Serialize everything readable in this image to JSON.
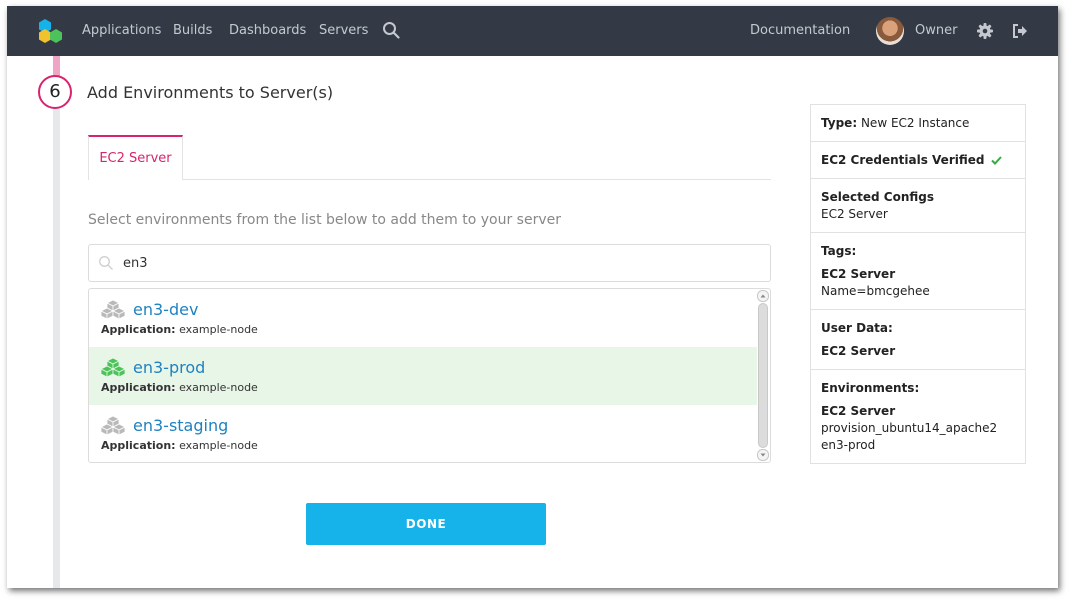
{
  "nav": {
    "items": [
      "Applications",
      "Builds",
      "Dashboards",
      "Servers"
    ],
    "documentation": "Documentation",
    "user": "Owner",
    "logo_colors": [
      "#16b2ea",
      "#f2c12e",
      "#4cc35a"
    ]
  },
  "step": {
    "number": "6",
    "title": "Add Environments to Server(s)"
  },
  "tabs": [
    {
      "label": "EC2 Server",
      "active": true
    }
  ],
  "instruction": "Select environments from the list below to add them to your server",
  "search": {
    "value": "en3",
    "placeholder": ""
  },
  "environments": [
    {
      "name": "en3-dev",
      "app_label": "Application:",
      "app_value": "example-node",
      "selected": false
    },
    {
      "name": "en3-prod",
      "app_label": "Application:",
      "app_value": "example-node",
      "selected": true
    },
    {
      "name": "en3-staging",
      "app_label": "Application:",
      "app_value": "example-node",
      "selected": false
    }
  ],
  "done_label": "DONE",
  "summary": {
    "type_label": "Type:",
    "type_value": "New EC2 Instance",
    "credentials": "EC2 Credentials Verified",
    "selected_configs_label": "Selected Configs",
    "selected_configs_value": "EC2 Server",
    "tags_label": "Tags:",
    "tags_server": "EC2 Server",
    "tags_value": "Name=bmcgehee",
    "user_data_label": "User Data:",
    "user_data_server": "EC2 Server",
    "environments_label": "Environments:",
    "environments_server": "EC2 Server",
    "environments_values": [
      "provision_ubuntu14_apache2",
      "en3-prod"
    ]
  },
  "colors": {
    "nav_bg": "#333a45",
    "accent_pink": "#d6246e",
    "link_blue": "#1f82c0",
    "done_button": "#16b2ea",
    "selected_row": "#e8f6e8",
    "check_green": "#3aa845"
  }
}
